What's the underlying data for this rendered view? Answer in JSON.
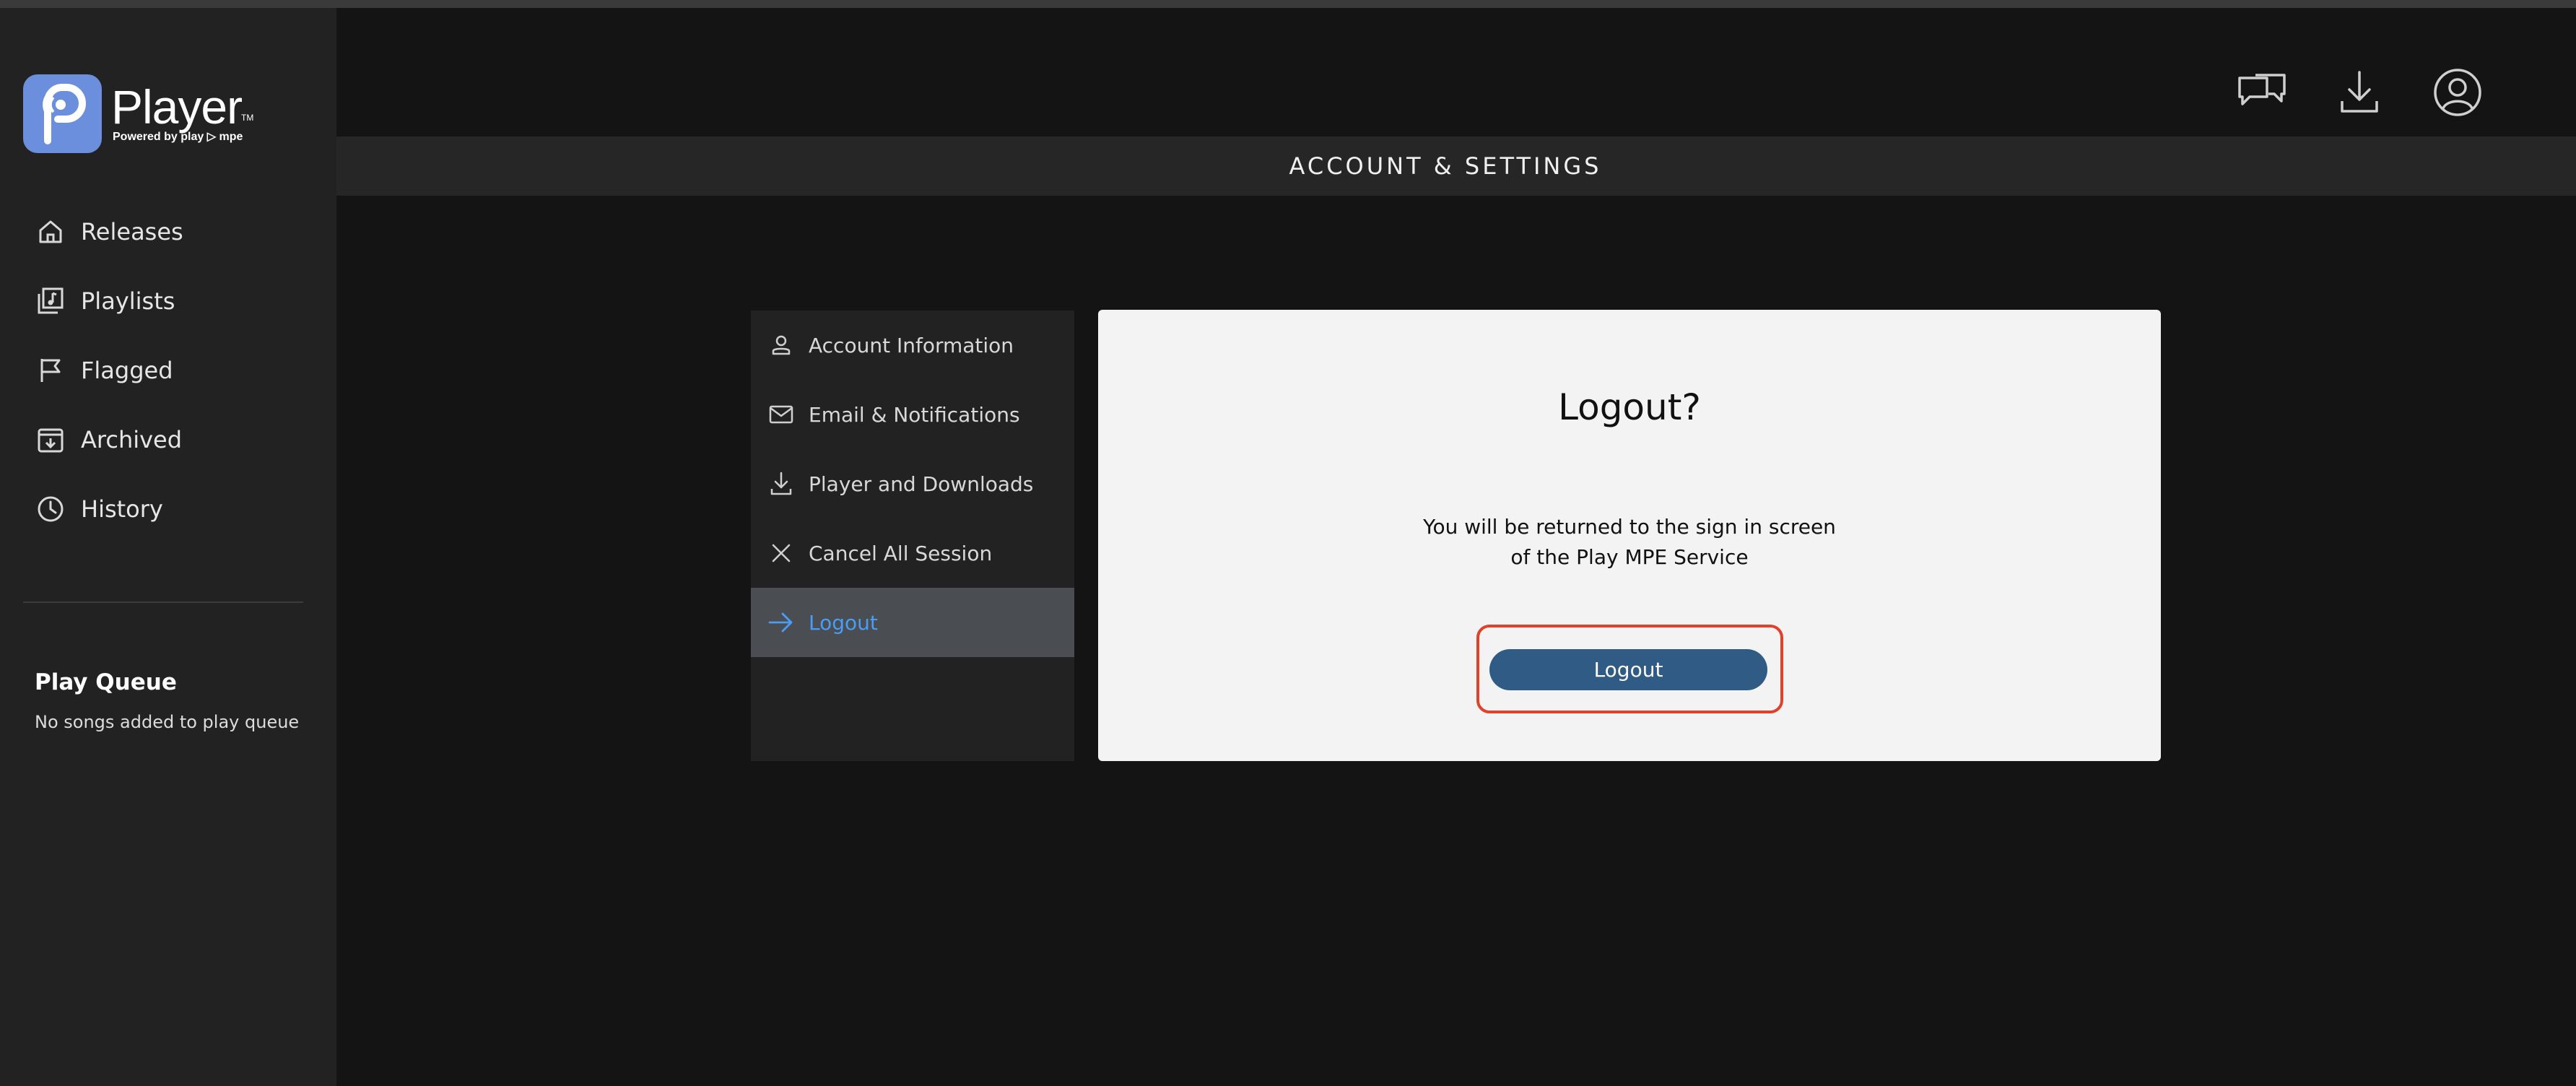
{
  "brand": {
    "name": "Player",
    "trademark": "TM",
    "powered_by": "Powered by play ▷ mpe",
    "accent": "#6b8fdc"
  },
  "sidebar": {
    "items": [
      {
        "label": "Releases",
        "icon": "home-icon"
      },
      {
        "label": "Playlists",
        "icon": "playlist-icon"
      },
      {
        "label": "Flagged",
        "icon": "flag-icon"
      },
      {
        "label": "Archived",
        "icon": "archive-icon"
      },
      {
        "label": "History",
        "icon": "clock-icon"
      }
    ],
    "play_queue": {
      "title": "Play Queue",
      "empty_text": "No songs added to play queue"
    }
  },
  "topbar": {
    "icons": [
      "chat-icon",
      "download-icon",
      "user-account-icon"
    ]
  },
  "header": {
    "title": "ACCOUNT & SETTINGS"
  },
  "settings_menu": {
    "items": [
      {
        "label": "Account Information",
        "icon": "person-icon"
      },
      {
        "label": "Email & Notifications",
        "icon": "mail-icon"
      },
      {
        "label": "Player and Downloads",
        "icon": "download-icon"
      },
      {
        "label": "Cancel All Session",
        "icon": "close-icon"
      },
      {
        "label": "Logout",
        "icon": "arrow-right-icon",
        "active": true
      }
    ]
  },
  "dialog": {
    "title": "Logout?",
    "message_line1": "You will be returned to the sign in screen",
    "message_line2": "of the Play MPE Service",
    "button_label": "Logout",
    "button_color": "#2f5b85",
    "highlight_color": "#e0412b"
  }
}
